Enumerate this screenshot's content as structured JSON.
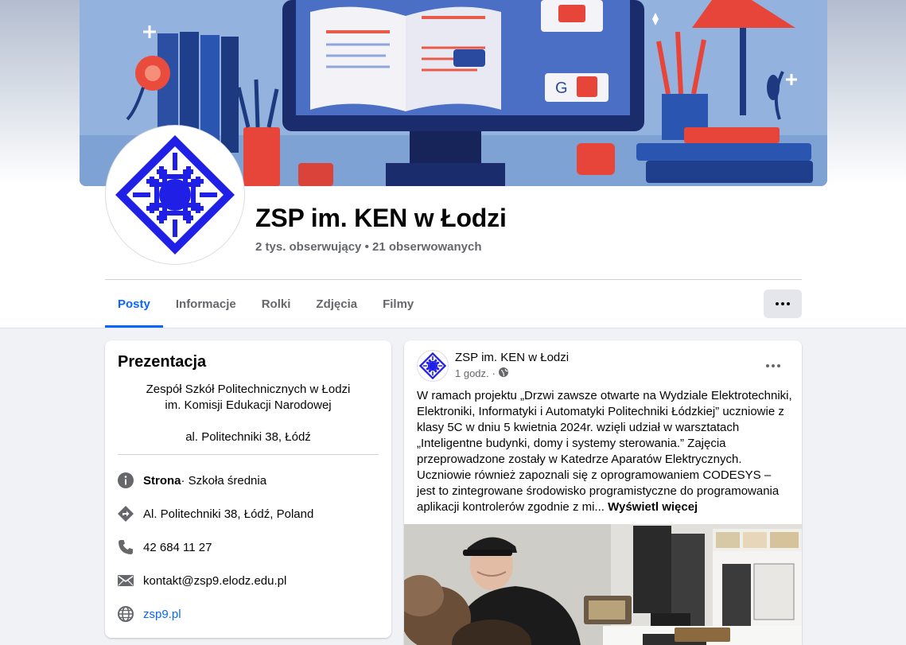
{
  "page": {
    "name": "ZSP im. KEN w Łodzi",
    "follow_stats": "2 tys. obserwujący • 21 obserwowanych"
  },
  "tabs": [
    {
      "label": "Posty",
      "active": true
    },
    {
      "label": "Informacje",
      "active": false
    },
    {
      "label": "Rolki",
      "active": false
    },
    {
      "label": "Zdjęcia",
      "active": false
    },
    {
      "label": "Filmy",
      "active": false
    }
  ],
  "intro": {
    "title": "Prezentacja",
    "description_line1": "Zespół Szkół Politechnicznych w Łodzi",
    "description_line2": "im. Komisji Edukacji Narodowej",
    "description_address": "al. Politechniki 38, Łódź",
    "rows": {
      "category_bold": "Strona",
      "category_rest": " · Szkoła średnia",
      "address": "Al. Politechniki 38, Łódź, Poland",
      "phone": "42 684 11 27",
      "email": "kontakt@zsp9.elodz.edu.pl",
      "website": "zsp9.pl"
    }
  },
  "post": {
    "author": "ZSP im. KEN w Łodzi",
    "time": "1 godz.",
    "separator": "·",
    "text": "W ramach projektu „Drzwi zawsze otwarte na Wydziale Elektrotechniki, Elektroniki, Informatyki i Automatyki Politechniki Łódzkiej” uczniowie z klasy 5C w dniu 5 kwietnia 2024r. wzięli udział w warsztatach „Inteligentne budynki, domy i systemy sterowania.” Zajęcia przeprowadzone zostały w Katedrze Aparatów Elektrycznych. Uczniowie również zapoznali się z oprogramowaniem CODESYS – jest to zintegrowane środowisko programistyczne do programowania aplikacji kontrolerów zgodnie z mi... ",
    "see_more": "Wyświetl więcej"
  },
  "colors": {
    "accent": "#0866ff",
    "logo_blue": "#1f1fe6",
    "secondary_text": "#65676b"
  },
  "icons": [
    "info-icon",
    "directions-icon",
    "phone-icon",
    "mail-icon",
    "globe-icon",
    "more-dots-icon",
    "globe-privacy-icon"
  ]
}
